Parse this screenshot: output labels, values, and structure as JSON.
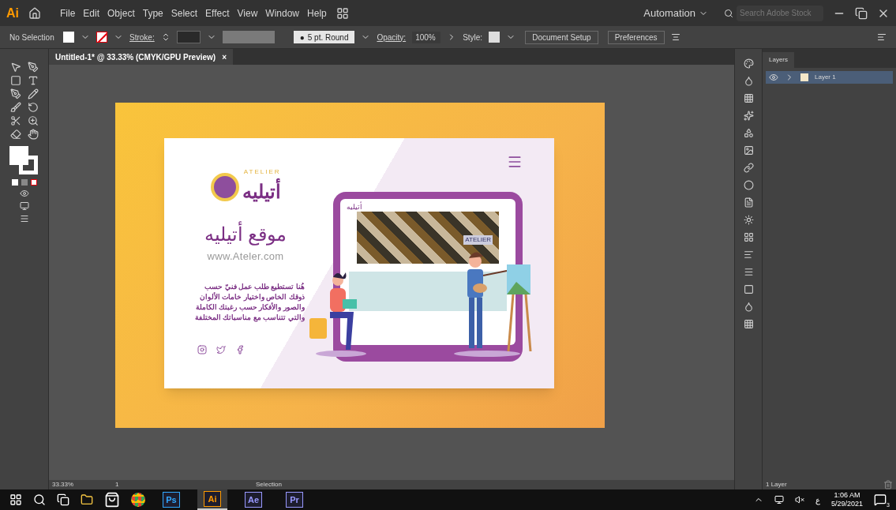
{
  "app": {
    "logo": "Ai"
  },
  "menu": [
    "File",
    "Edit",
    "Object",
    "Type",
    "Select",
    "Effect",
    "View",
    "Window",
    "Help"
  ],
  "workspace": {
    "label": "Automation",
    "search_placeholder": "Search Adobe Stock"
  },
  "control_bar": {
    "selection": "No Selection",
    "stroke_label": "Stroke:",
    "brush_bullet": "●",
    "brush": "5 pt. Round",
    "opacity_label": "Opacity:",
    "opacity": "100%",
    "style_label": "Style:",
    "buttons": [
      "Document Setup",
      "Preferences"
    ]
  },
  "document_tabs": [
    {
      "title": "Untitled-1* @ 33.33% (CMYK/GPU Preview)",
      "close": "×",
      "selected": true
    }
  ],
  "artwork": {
    "logo_latin": "ATELIER",
    "logo_arabic": "أتيليه",
    "heading": "موقع أتيليه",
    "url": "www.Ateler.com",
    "paragraph": [
      "هُنا تستطيع طلب عمل فنيّ حسب",
      "ذوقك الخاص واختيار خامات الألوان",
      "والصور والأفكار حسب رغبتك الكاملة",
      "والتي تتناسب مع مناسباتك المختلفة"
    ],
    "mock_site": {
      "logo": "أتيليه",
      "badge": "ATELIER"
    }
  },
  "layers_panel": {
    "tab": "Layers",
    "layers": [
      {
        "name": "Layer 1",
        "selected": true,
        "visible": true
      }
    ],
    "count": "1 Layer"
  },
  "status_bar": {
    "zoom": "33.33%",
    "artboard": "1",
    "tool": "Selection"
  },
  "taskbar": {
    "apps": [
      {
        "kind": "store"
      },
      {
        "kind": "chrome"
      },
      {
        "kind": "ps",
        "label": "Ps",
        "color": "#31a8ff",
        "selected": false
      },
      {
        "kind": "ai",
        "label": "Ai",
        "color": "#ff9a00",
        "selected": true
      },
      {
        "kind": "ae",
        "label": "Ae",
        "color": "#9999ff",
        "selected": false
      },
      {
        "kind": "pr",
        "label": "Pr",
        "color": "#9999ff",
        "selected": false
      }
    ],
    "language": "ع",
    "time": "1:06 AM",
    "date": "5/29/2021",
    "notifications": "3"
  }
}
